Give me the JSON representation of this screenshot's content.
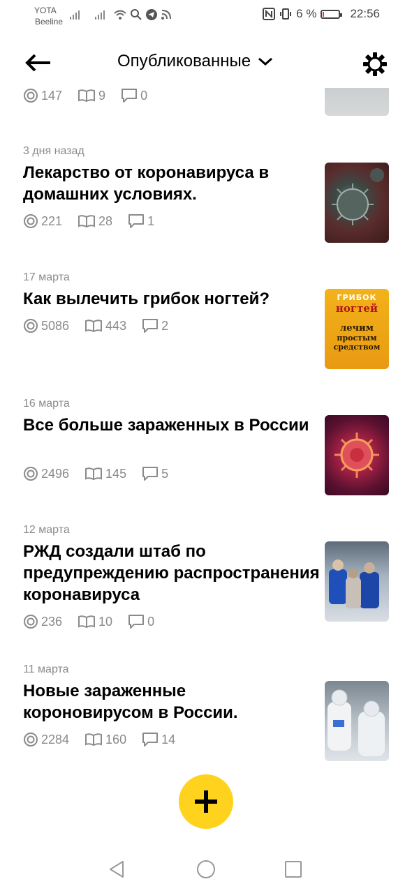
{
  "status_bar": {
    "carrier1": "YOTA",
    "carrier2": "Beeline",
    "battery_text": "6 %",
    "battery_level": 0.06,
    "time": "22:56"
  },
  "header": {
    "title": "Опубликованные"
  },
  "articles": [
    {
      "date": "",
      "title": "",
      "views": "147",
      "reads": "9",
      "comments": "0"
    },
    {
      "date": "3 дня назад",
      "title": "Лекарство от коронавируса в домашних условиях.",
      "views": "221",
      "reads": "28",
      "comments": "1"
    },
    {
      "date": "17 марта",
      "title": "Как вылечить грибок ногтей?",
      "views": "5086",
      "reads": "443",
      "comments": "2",
      "thumb_text": {
        "line1": "ГРИБОК",
        "line2": "ногтей",
        "line3": "лечим",
        "line4": "простым",
        "line5": "средством"
      }
    },
    {
      "date": "16 марта",
      "title": "Все больше зараженных в России",
      "views": "2496",
      "reads": "145",
      "comments": "5"
    },
    {
      "date": "12 марта",
      "title": "РЖД создали штаб по предупреждению распространения коронавируса",
      "views": "236",
      "reads": "10",
      "comments": "0"
    },
    {
      "date": "11 марта",
      "title": "Новые зараженные короновирусом в России.",
      "views": "2284",
      "reads": "160",
      "comments": "14"
    }
  ],
  "colors": {
    "fab": "#ffd21e",
    "meta_gray": "#8a8a8a",
    "battery_low": "#e53935"
  }
}
